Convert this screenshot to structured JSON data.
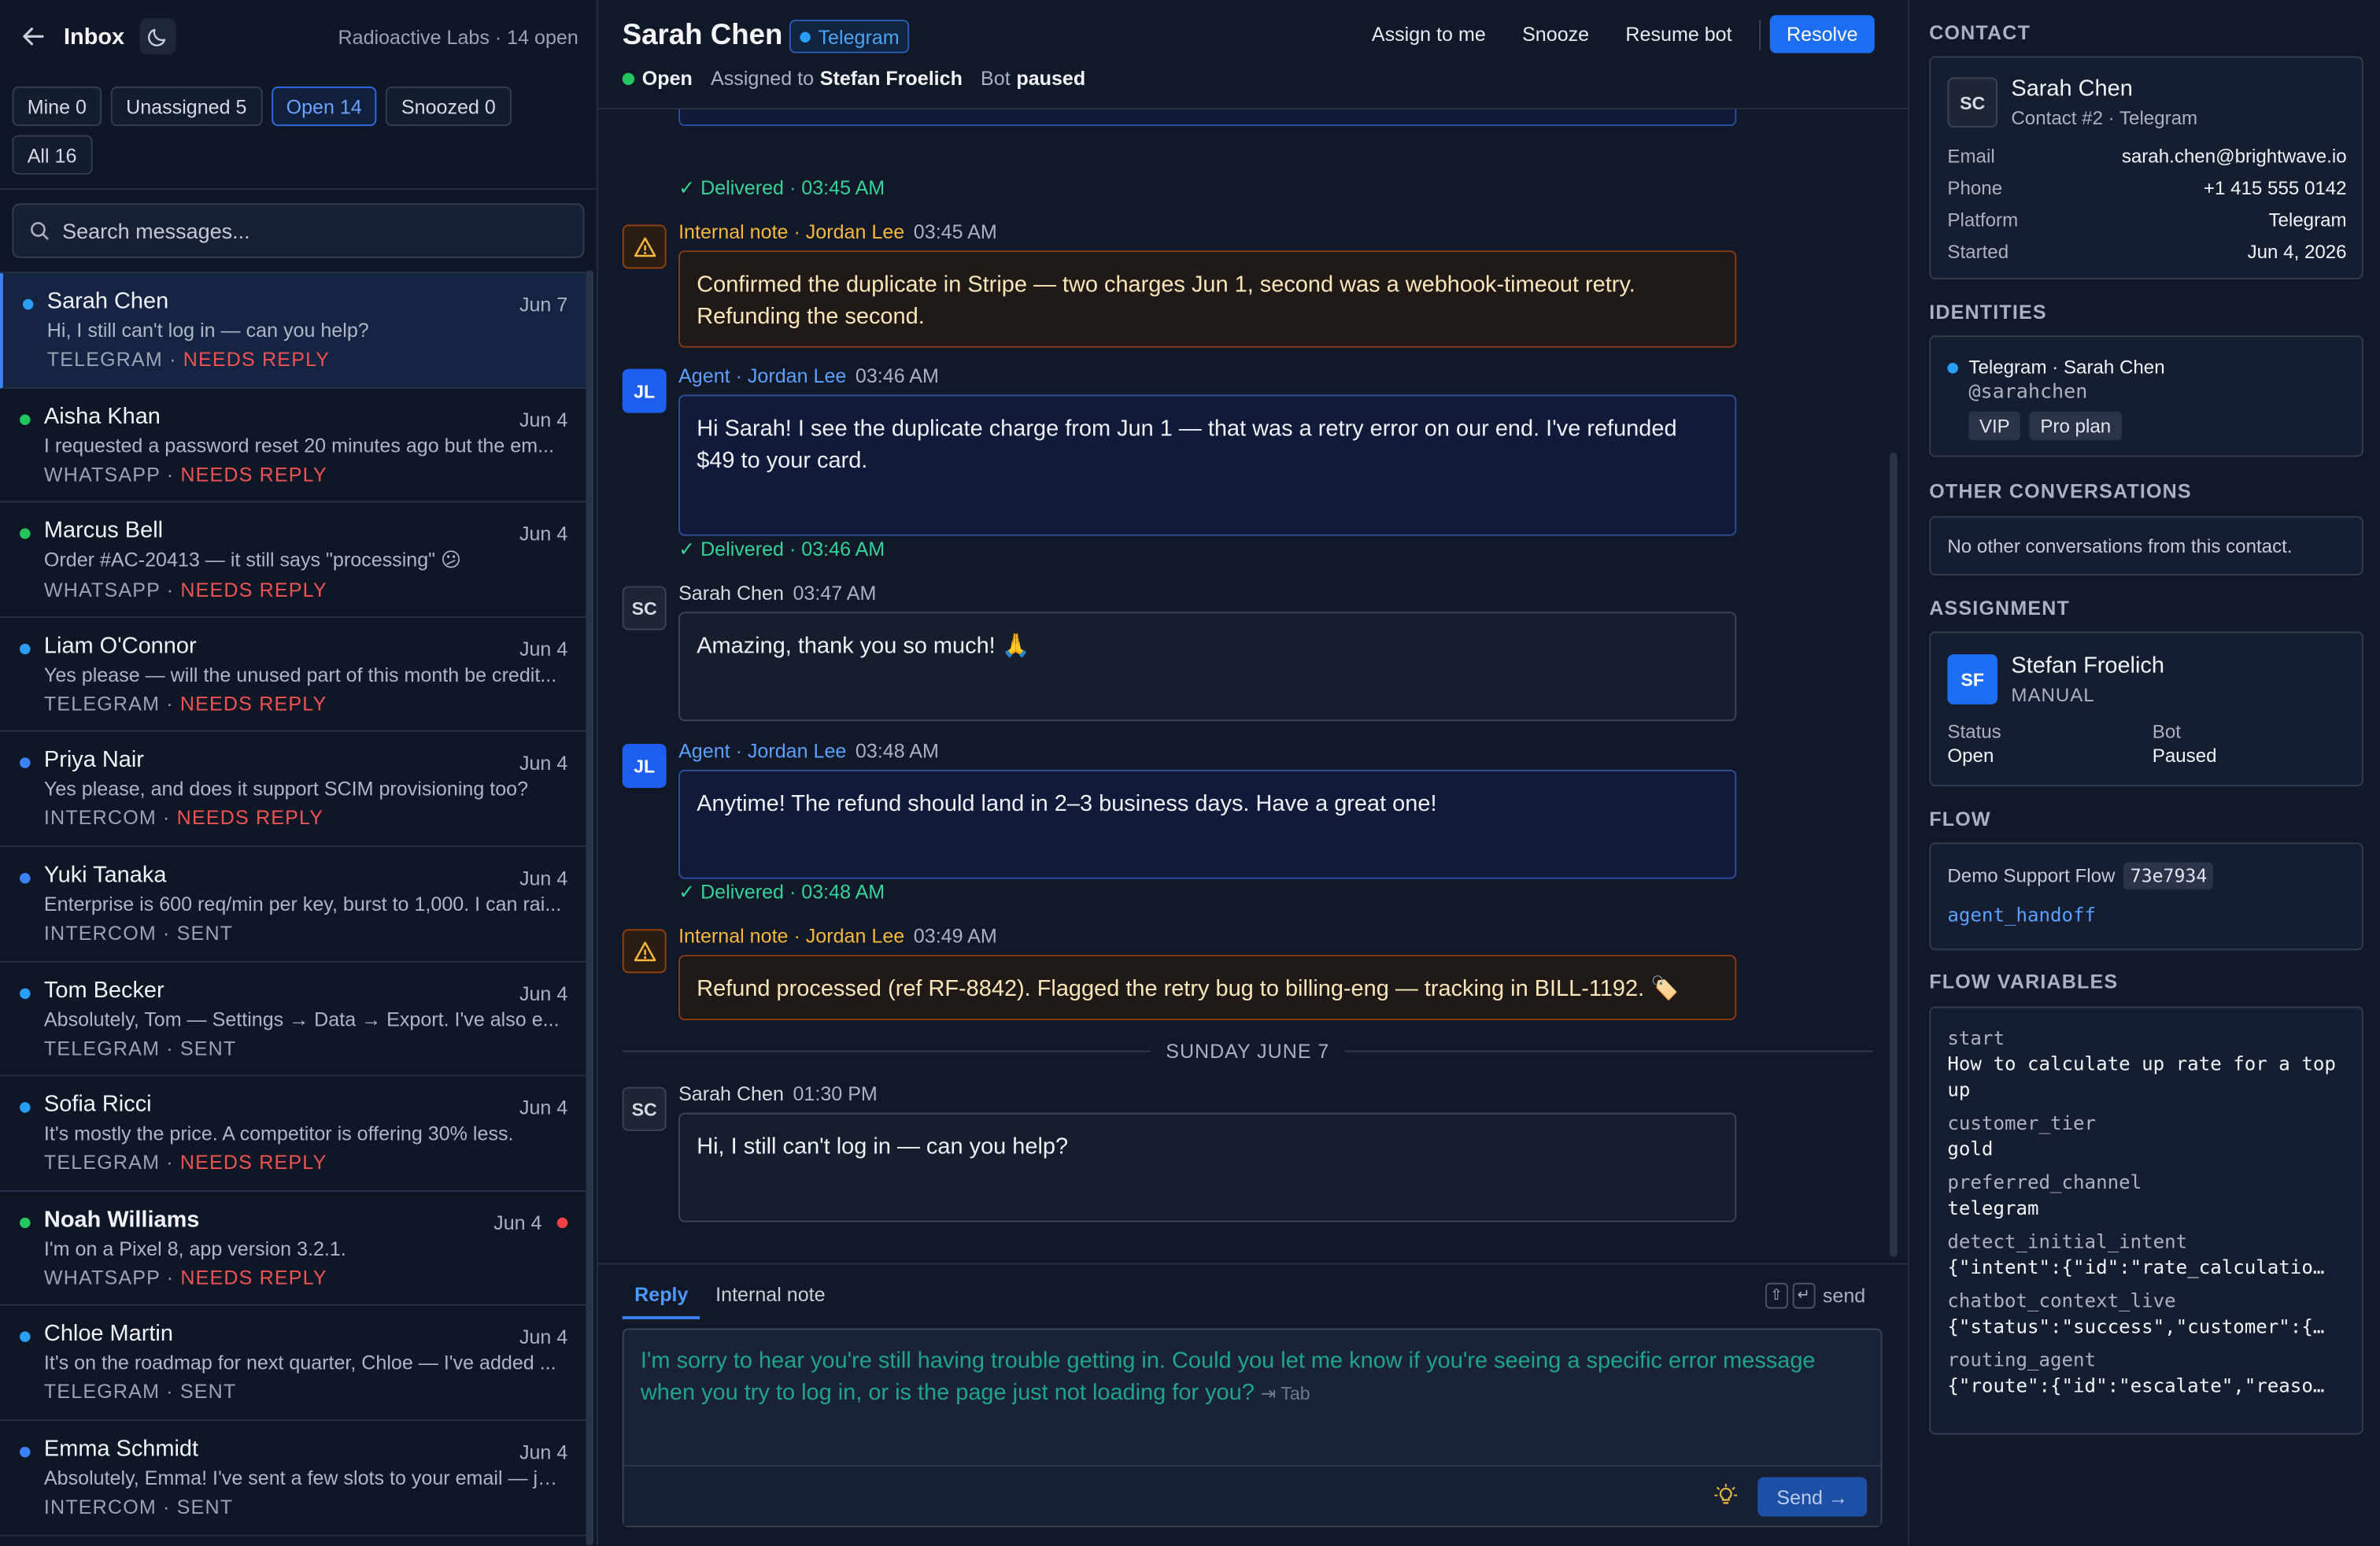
{
  "sidebar": {
    "title": "Inbox",
    "org_line": "Radioactive Labs · 14 open",
    "filters": [
      {
        "label": "Mine 0"
      },
      {
        "label": "Unassigned 5"
      },
      {
        "label": "Open 14"
      },
      {
        "label": "Snoozed 0"
      },
      {
        "label": "All 16"
      }
    ],
    "search_placeholder": "Search messages...",
    "conversations": [
      {
        "name": "Sarah Chen",
        "date": "Jun 7",
        "preview": "Hi, I still can't log in — can you help?",
        "channel": "TELEGRAM",
        "status": "NEEDS REPLY",
        "dot_color": "#2a9df4"
      },
      {
        "name": "Aisha Khan",
        "date": "Jun 4",
        "preview": "I requested a password reset 20 minutes ago but the em...",
        "channel": "WHATSAPP",
        "status": "NEEDS REPLY",
        "dot_color": "#22c55e"
      },
      {
        "name": "Marcus Bell",
        "date": "Jun 4",
        "preview": "Order #AC-20413 — it still says \"processing\" 😕",
        "channel": "WHATSAPP",
        "status": "NEEDS REPLY",
        "dot_color": "#22c55e"
      },
      {
        "name": "Liam O'Connor",
        "date": "Jun 4",
        "preview": "Yes please — will the unused part of this month be credit...",
        "channel": "TELEGRAM",
        "status": "NEEDS REPLY",
        "dot_color": "#2a9df4"
      },
      {
        "name": "Priya Nair",
        "date": "Jun 4",
        "preview": "Yes please, and does it support SCIM provisioning too?",
        "channel": "INTERCOM",
        "status": "NEEDS REPLY",
        "dot_color": "#3b82f6"
      },
      {
        "name": "Yuki Tanaka",
        "date": "Jun 4",
        "preview": "Enterprise is 600 req/min per key, burst to 1,000. I can rai...",
        "channel": "INTERCOM",
        "status": "SENT",
        "dot_color": "#3b82f6"
      },
      {
        "name": "Tom Becker",
        "date": "Jun 4",
        "preview": "Absolutely, Tom — Settings → Data → Export. I've also e...",
        "channel": "TELEGRAM",
        "status": "SENT",
        "dot_color": "#2a9df4"
      },
      {
        "name": "Sofia Ricci",
        "date": "Jun 4",
        "preview": "It's mostly the price. A competitor is offering 30% less.",
        "channel": "TELEGRAM",
        "status": "NEEDS REPLY",
        "dot_color": "#2a9df4"
      },
      {
        "name": "Noah Williams",
        "date": "Jun 4",
        "preview": "I'm on a Pixel 8, app version 3.2.1.",
        "channel": "WHATSAPP",
        "status": "NEEDS REPLY",
        "dot_color": "#22c55e"
      },
      {
        "name": "Chloe Martin",
        "date": "Jun 4",
        "preview": "It's on the roadmap for next quarter, Chloe — I've added ...",
        "channel": "TELEGRAM",
        "status": "SENT",
        "dot_color": "#2a9df4"
      },
      {
        "name": "Emma Schmidt",
        "date": "Jun 4",
        "preview": "Absolutely, Emma! I've sent a few slots to your email — ju...",
        "channel": "INTERCOM",
        "status": "SENT",
        "dot_color": "#3b82f6"
      }
    ]
  },
  "header": {
    "name": "Sarah Chen",
    "channel_badge": "Telegram",
    "status": "Open",
    "assigned_prefix": "Assigned to",
    "assigned_to": "Stefan Froelich",
    "bot_prefix": "Bot",
    "bot_state": "paused",
    "actions": {
      "assign": "Assign to me",
      "snooze": "Snooze",
      "resume_bot": "Resume bot",
      "resolve": "Resolve"
    }
  },
  "thread": {
    "messages": [
      {
        "kind": "delivered",
        "text": "Delivered · 03:45 AM"
      },
      {
        "kind": "note",
        "author": "Internal note · Jordan Lee",
        "time": "03:45 AM",
        "text": "Confirmed the duplicate in Stripe — two charges Jun 1, second was a webhook-timeout retry. Refunding the second."
      },
      {
        "kind": "agent",
        "avatar": "JL",
        "author": "Agent · Jordan Lee",
        "time": "03:46 AM",
        "text": "Hi Sarah! I see the duplicate charge from Jun 1 — that was a retry error on our end. I've refunded $49 to your card.",
        "delivered": "Delivered · 03:46 AM"
      },
      {
        "kind": "contact",
        "avatar": "SC",
        "author": "Sarah Chen",
        "time": "03:47 AM",
        "text": "Amazing, thank you so much! 🙏"
      },
      {
        "kind": "agent",
        "avatar": "JL",
        "author": "Agent · Jordan Lee",
        "time": "03:48 AM",
        "text": "Anytime! The refund should land in 2–3 business days. Have a great one!",
        "delivered": "Delivered · 03:48 AM"
      },
      {
        "kind": "note",
        "author": "Internal note · Jordan Lee",
        "time": "03:49 AM",
        "text": "Refund processed (ref RF-8842). Flagged the retry bug to billing-eng — tracking in BILL-1192. 🏷️"
      },
      {
        "kind": "day",
        "text": "SUNDAY JUNE 7"
      },
      {
        "kind": "contact",
        "avatar": "SC",
        "author": "Sarah Chen",
        "time": "01:30 PM",
        "text": "Hi, I still can't log in — can you help?"
      }
    ]
  },
  "composer": {
    "tabs": [
      "Reply",
      "Internal note"
    ],
    "send_hint": "send",
    "draft": "I'm sorry to hear you're still having trouble getting in. Could you let me know if you're seeing a specific error message when you try to log in, or is the page just not loading for you?",
    "draft_hint": "⇥ Tab",
    "send_label": "Send →"
  },
  "contact": {
    "section": "CONTACT",
    "initials": "SC",
    "name": "Sarah Chen",
    "subtitle": "Contact #2 · Telegram",
    "fields": [
      {
        "k": "Email",
        "v": "sarah.chen@brightwave.io"
      },
      {
        "k": "Phone",
        "v": "+1 415 555 0142"
      },
      {
        "k": "Platform",
        "v": "Telegram"
      },
      {
        "k": "Started",
        "v": "Jun 4, 2026"
      }
    ]
  },
  "identities": {
    "section": "IDENTITIES",
    "label": "Telegram · Sarah Chen",
    "handle": "@sarahchen",
    "tags": [
      "VIP",
      "Pro plan"
    ]
  },
  "other_conversations": {
    "section": "OTHER CONVERSATIONS",
    "empty_text": "No other conversations from this contact."
  },
  "assignment": {
    "section": "ASSIGNMENT",
    "initials": "SF",
    "name": "Stefan Froelich",
    "mode": "MANUAL",
    "status_label": "Status",
    "status_value": "Open",
    "bot_label": "Bot",
    "bot_value": "Paused"
  },
  "flow": {
    "section": "FLOW",
    "name": "Demo Support Flow",
    "id": "73e7934",
    "node": "agent_handoff"
  },
  "flow_variables": {
    "section": "FLOW VARIABLES",
    "vars": [
      {
        "k": "start",
        "v": "How to calculate up rate for a top up"
      },
      {
        "k": "customer_tier",
        "v": "gold"
      },
      {
        "k": "preferred_channel",
        "v": "telegram"
      },
      {
        "k": "detect_initial_intent",
        "v": "{\"intent\":{\"id\":\"rate_calculatio…"
      },
      {
        "k": "chatbot_context_live",
        "v": "{\"status\":\"success\",\"customer\":{…"
      },
      {
        "k": "routing_agent",
        "v": "{\"route\":{\"id\":\"escalate\",\"reaso…"
      }
    ]
  },
  "colors": {
    "accent": "#1d6ef2",
    "needs_reply": "#ef5353",
    "delivered": "#34d399",
    "note": "#f5b83d"
  }
}
